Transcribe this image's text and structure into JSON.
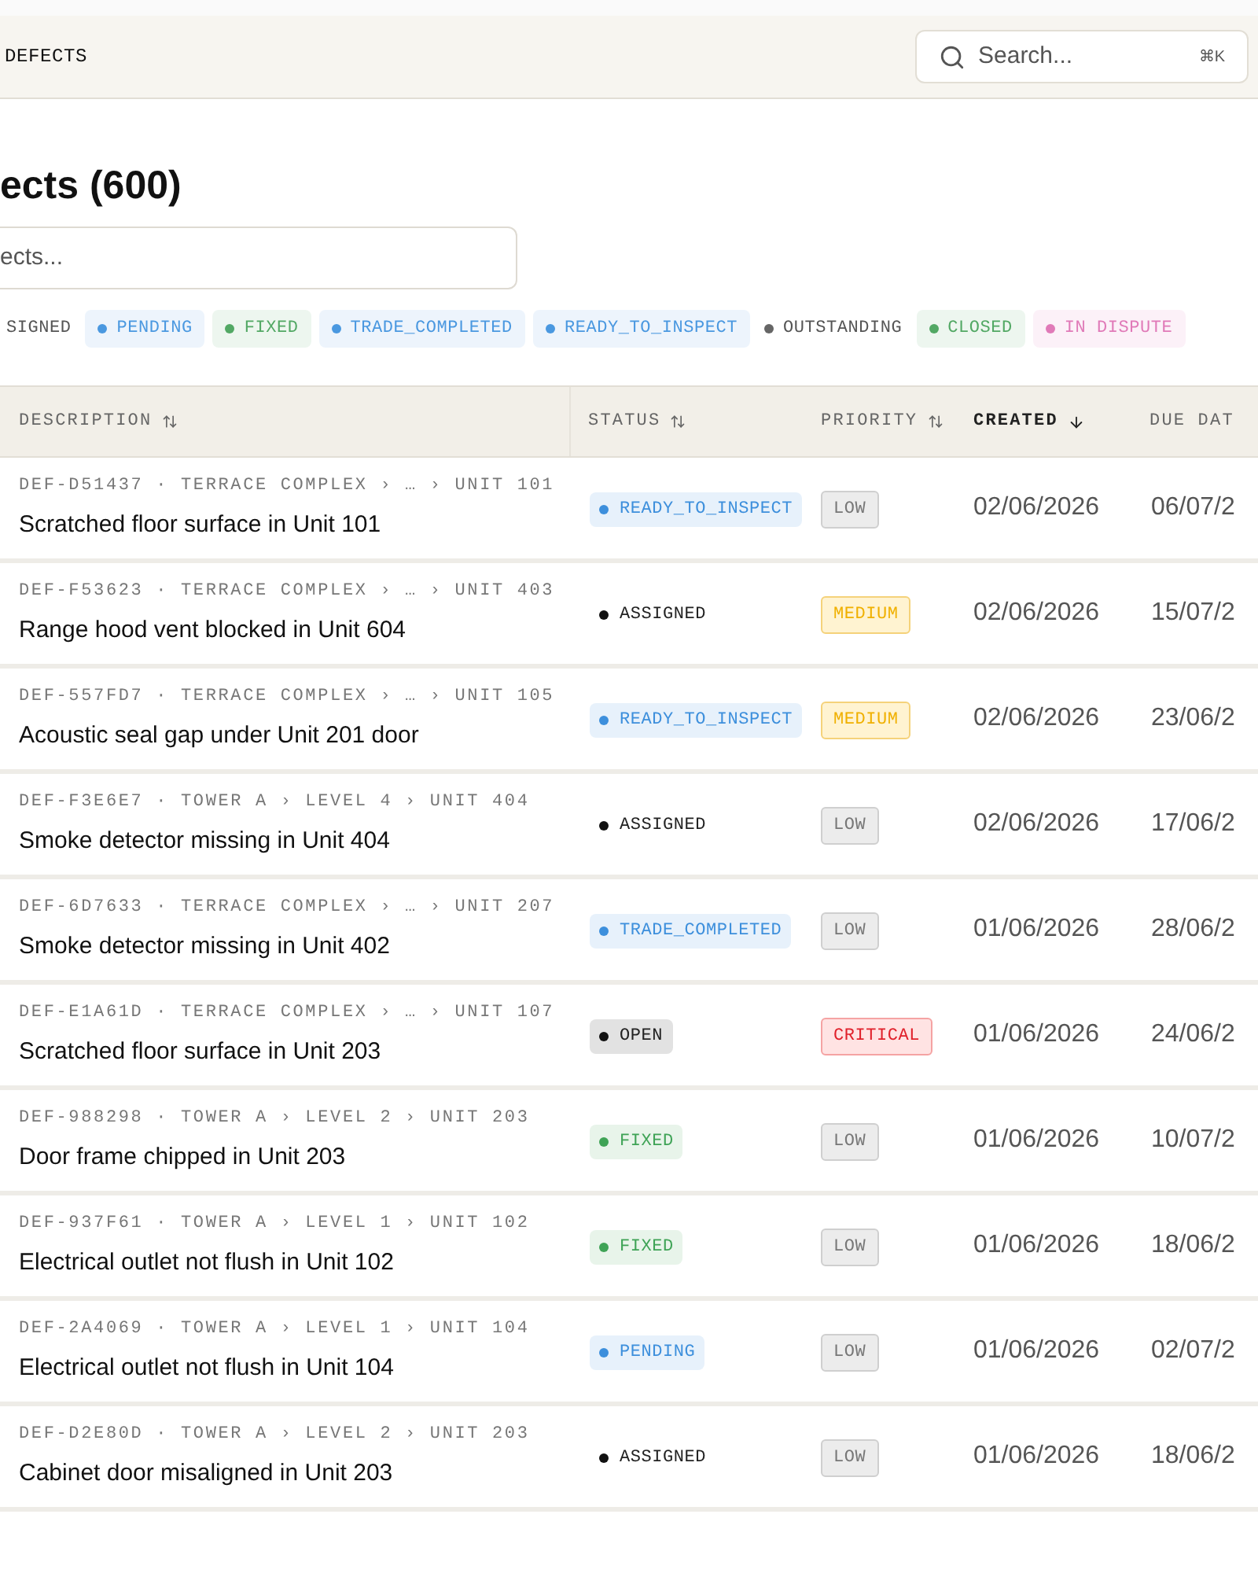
{
  "topbar": {
    "breadcrumb": "DEFECTS",
    "search": {
      "placeholder": "Search...",
      "shortcut": "⌘K"
    }
  },
  "page": {
    "title": "ects (600)",
    "filter_field": {
      "placeholder": "ects..."
    }
  },
  "status_filters": [
    {
      "label": "SIGNED",
      "kind": "plain"
    },
    {
      "label": "PENDING",
      "kind": "badge",
      "color": "#4a98e0"
    },
    {
      "label": "FIXED",
      "kind": "badge",
      "color": "#52a864"
    },
    {
      "label": "TRADE_COMPLETED",
      "kind": "badge",
      "color": "#4a98e0"
    },
    {
      "label": "READY_TO_INSPECT",
      "kind": "badge",
      "color": "#4a98e0"
    },
    {
      "label": "OUTSTANDING",
      "kind": "plain",
      "color": "#666666"
    },
    {
      "label": "CLOSED",
      "kind": "badge",
      "color": "#52a864"
    },
    {
      "label": "IN DISPUTE",
      "kind": "badge",
      "color": "#e07ab8"
    }
  ],
  "table": {
    "columns": [
      {
        "label": "DESCRIPTION",
        "sortable": true,
        "selected": false
      },
      {
        "label": "STATUS",
        "sortable": true,
        "selected": false
      },
      {
        "label": "PRIORITY",
        "sortable": true,
        "selected": false
      },
      {
        "label": "CREATED",
        "sortable": true,
        "selected": true
      },
      {
        "label": "DUE DAT",
        "sortable": false,
        "selected": false
      }
    ],
    "rows": [
      {
        "ref": "DEF-D51437 · TERRACE COMPLEX › … › UNIT 101",
        "description": "Scratched floor surface in Unit 101",
        "status": {
          "label": "READY_TO_INSPECT",
          "kind": "badge",
          "color": "#3d8fdc"
        },
        "priority": {
          "label": "LOW",
          "kind": "low"
        },
        "created": "02/06/2026",
        "due": "06/07/2"
      },
      {
        "ref": "DEF-F53623 · TERRACE COMPLEX › … › UNIT 403",
        "description": "Range hood vent blocked in Unit 604",
        "status": {
          "label": "ASSIGNED",
          "kind": "plain",
          "color": "#111111"
        },
        "priority": {
          "label": "MEDIUM",
          "kind": "medium"
        },
        "created": "02/06/2026",
        "due": "15/07/2"
      },
      {
        "ref": "DEF-557FD7 · TERRACE COMPLEX › … › UNIT 105",
        "description": "Acoustic seal gap under Unit 201 door",
        "status": {
          "label": "READY_TO_INSPECT",
          "kind": "badge",
          "color": "#3d8fdc"
        },
        "priority": {
          "label": "MEDIUM",
          "kind": "medium"
        },
        "created": "02/06/2026",
        "due": "23/06/2"
      },
      {
        "ref": "DEF-F3E6E7 · TOWER A › LEVEL 4 › UNIT 404",
        "description": "Smoke detector missing in Unit 404",
        "status": {
          "label": "ASSIGNED",
          "kind": "plain",
          "color": "#111111"
        },
        "priority": {
          "label": "LOW",
          "kind": "low"
        },
        "created": "02/06/2026",
        "due": "17/06/2"
      },
      {
        "ref": "DEF-6D7633 · TERRACE COMPLEX › … › UNIT 207",
        "description": "Smoke detector missing in Unit 402",
        "status": {
          "label": "TRADE_COMPLETED",
          "kind": "badge",
          "color": "#3d8fdc"
        },
        "priority": {
          "label": "LOW",
          "kind": "low"
        },
        "created": "01/06/2026",
        "due": "28/06/2"
      },
      {
        "ref": "DEF-E1A61D · TERRACE COMPLEX › … › UNIT 107",
        "description": "Scratched floor surface in Unit 203",
        "status": {
          "label": "OPEN",
          "kind": "gray",
          "color": "#111111"
        },
        "priority": {
          "label": "CRITICAL",
          "kind": "critical"
        },
        "created": "01/06/2026",
        "due": "24/06/2"
      },
      {
        "ref": "DEF-988298 · TOWER A › LEVEL 2 › UNIT 203",
        "description": "Door frame chipped in Unit 203",
        "status": {
          "label": "FIXED",
          "kind": "badge",
          "color": "#3fa356"
        },
        "priority": {
          "label": "LOW",
          "kind": "low"
        },
        "created": "01/06/2026",
        "due": "10/07/2"
      },
      {
        "ref": "DEF-937F61 · TOWER A › LEVEL 1 › UNIT 102",
        "description": "Electrical outlet not flush in Unit 102",
        "status": {
          "label": "FIXED",
          "kind": "badge",
          "color": "#3fa356"
        },
        "priority": {
          "label": "LOW",
          "kind": "low"
        },
        "created": "01/06/2026",
        "due": "18/06/2"
      },
      {
        "ref": "DEF-2A4069 · TOWER A › LEVEL 1 › UNIT 104",
        "description": "Electrical outlet not flush in Unit 104",
        "status": {
          "label": "PENDING",
          "kind": "badge",
          "color": "#3d8fdc"
        },
        "priority": {
          "label": "LOW",
          "kind": "low"
        },
        "created": "01/06/2026",
        "due": "02/07/2"
      },
      {
        "ref": "DEF-D2E80D · TOWER A › LEVEL 2 › UNIT 203",
        "description": "Cabinet door misaligned in Unit 203",
        "status": {
          "label": "ASSIGNED",
          "kind": "plain",
          "color": "#111111"
        },
        "priority": {
          "label": "LOW",
          "kind": "low"
        },
        "created": "01/06/2026",
        "due": "18/06/2"
      }
    ]
  }
}
